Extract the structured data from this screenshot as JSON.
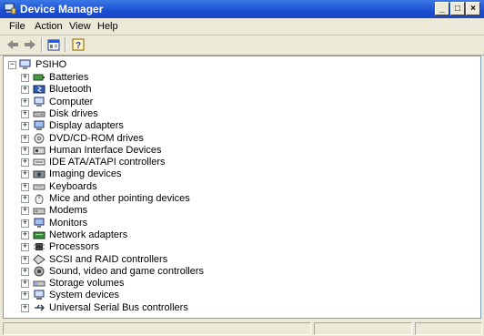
{
  "window": {
    "title": "Device Manager"
  },
  "titlebar_buttons": {
    "minimize": "_",
    "maximize": "□",
    "close": "×"
  },
  "menu": [
    "File",
    "Action",
    "View",
    "Help"
  ],
  "toolbar": {
    "icons": [
      "back-arrow-icon",
      "forward-arrow-icon",
      "properties-icon",
      "help-icon"
    ]
  },
  "tree": {
    "root": {
      "label": "PSIHO",
      "expander": "−"
    },
    "items": [
      {
        "label": "Batteries",
        "icon": "battery-icon",
        "expander": "+"
      },
      {
        "label": "Bluetooth",
        "icon": "bluetooth-icon",
        "expander": "+"
      },
      {
        "label": "Computer",
        "icon": "computer-icon",
        "expander": "+"
      },
      {
        "label": "Disk drives",
        "icon": "disk-drive-icon",
        "expander": "+"
      },
      {
        "label": "Display adapters",
        "icon": "display-adapter-icon",
        "expander": "+"
      },
      {
        "label": "DVD/CD-ROM drives",
        "icon": "dvd-drive-icon",
        "expander": "+"
      },
      {
        "label": "Human Interface Devices",
        "icon": "hid-icon",
        "expander": "+"
      },
      {
        "label": "IDE ATA/ATAPI controllers",
        "icon": "ide-controller-icon",
        "expander": "+"
      },
      {
        "label": "Imaging devices",
        "icon": "camera-icon",
        "expander": "+"
      },
      {
        "label": "Keyboards",
        "icon": "keyboard-icon",
        "expander": "+"
      },
      {
        "label": "Mice and other pointing devices",
        "icon": "mouse-icon",
        "expander": "+"
      },
      {
        "label": "Modems",
        "icon": "modem-icon",
        "expander": "+"
      },
      {
        "label": "Monitors",
        "icon": "monitor-icon",
        "expander": "+"
      },
      {
        "label": "Network adapters",
        "icon": "network-adapter-icon",
        "expander": "+"
      },
      {
        "label": "Processors",
        "icon": "processor-icon",
        "expander": "+"
      },
      {
        "label": "SCSI and RAID controllers",
        "icon": "scsi-controller-icon",
        "expander": "+"
      },
      {
        "label": "Sound, video and game controllers",
        "icon": "sound-icon",
        "expander": "+"
      },
      {
        "label": "Storage volumes",
        "icon": "storage-volume-icon",
        "expander": "+"
      },
      {
        "label": "System devices",
        "icon": "system-devices-icon",
        "expander": "+"
      },
      {
        "label": "Universal Serial Bus controllers",
        "icon": "usb-icon",
        "expander": "+"
      }
    ]
  },
  "colors": {
    "titlebar": "#1b4fd1",
    "window_bg": "#ece9d8",
    "tree_bg": "#ffffff"
  }
}
